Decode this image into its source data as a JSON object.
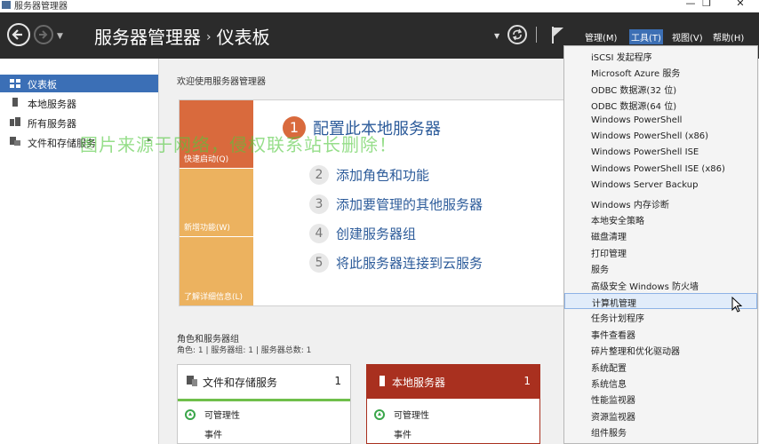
{
  "window": {
    "title": "服务器管理器",
    "controls": [
      "—",
      "❐",
      "✕"
    ]
  },
  "header": {
    "breadcrumb_root": "服务器管理器",
    "breadcrumb_sep": "›",
    "breadcrumb_page": "仪表板",
    "menu": {
      "manage": "管理(M)",
      "tools": "工具(T)",
      "view": "视图(V)",
      "help": "帮助(H)"
    }
  },
  "sidebar": {
    "items": [
      {
        "label": "仪表板",
        "icon": "dashboard-icon"
      },
      {
        "label": "本地服务器",
        "icon": "server-icon"
      },
      {
        "label": "所有服务器",
        "icon": "servers-icon"
      },
      {
        "label": "文件和存储服务",
        "icon": "storage-icon",
        "arrow": "▸"
      }
    ]
  },
  "main": {
    "welcome": "欢迎使用服务器管理器",
    "tiles": [
      "快速启动(Q)",
      "新增功能(W)",
      "了解详细信息(L)"
    ],
    "steps": [
      {
        "num": "1",
        "label": "配置此本地服务器"
      },
      {
        "num": "2",
        "label": "添加角色和功能"
      },
      {
        "num": "3",
        "label": "添加要管理的其他服务器"
      },
      {
        "num": "4",
        "label": "创建服务器组"
      },
      {
        "num": "5",
        "label": "将此服务器连接到云服务"
      }
    ],
    "roles_title": "角色和服务器组",
    "roles_summary": "角色: 1 | 服务器组: 1 | 服务器总数: 1",
    "cards": [
      {
        "title": "文件和存储服务",
        "count": "1",
        "rows": [
          "可管理性",
          "事件"
        ]
      },
      {
        "title": "本地服务器",
        "count": "1",
        "rows": [
          "可管理性",
          "事件"
        ]
      }
    ]
  },
  "watermark": "图片来源于网络，侵权联系站长删除！",
  "tools_menu": {
    "items": [
      "iSCSI 发起程序",
      "Microsoft Azure 服务",
      "ODBC 数据源(32 位)",
      "ODBC 数据源(64 位)",
      "Windows PowerShell",
      "Windows PowerShell (x86)",
      "Windows PowerShell ISE",
      "Windows PowerShell ISE (x86)",
      "Windows Server Backup",
      "Windows 内存诊断",
      "本地安全策略",
      "磁盘清理",
      "打印管理",
      "服务",
      "高级安全 Windows 防火墙",
      "计算机管理",
      "任务计划程序",
      "事件查看器",
      "碎片整理和优化驱动器",
      "系统配置",
      "系统信息",
      "性能监视器",
      "资源监视器",
      "组件服务"
    ],
    "hovered": "计算机管理"
  },
  "colors": {
    "header_bg": "#2b2b2b",
    "accent_blue": "#3b6fb6",
    "tile_orange": "#d96a3d",
    "tile_yellow": "#ecb25f",
    "card_red": "#a9301f",
    "ok_green": "#3aa64a"
  }
}
